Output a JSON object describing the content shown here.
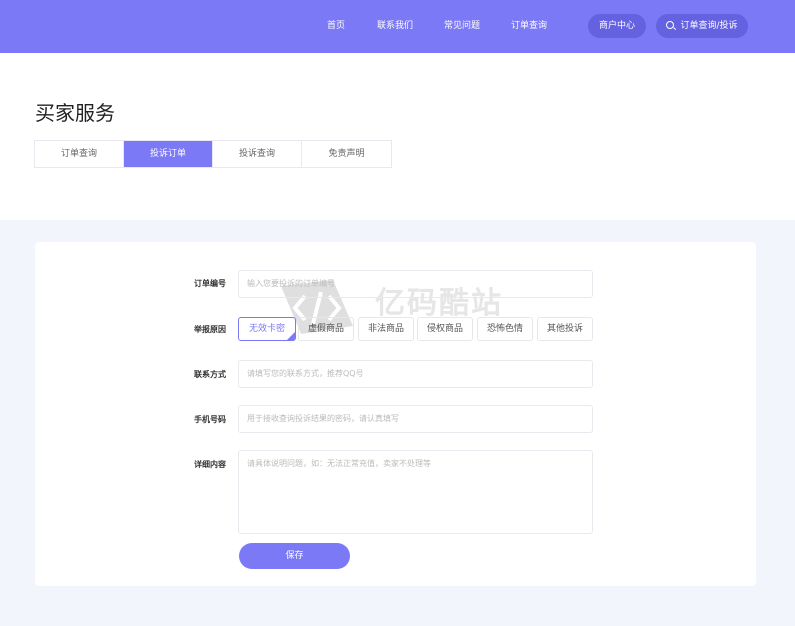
{
  "header": {
    "nav": [
      "首页",
      "联系我们",
      "常见问题",
      "订单查询"
    ],
    "merchant_button": "商户中心",
    "search_button": "订单查询/投诉"
  },
  "hero": {
    "title": "买家服务",
    "tabs": [
      "订单查询",
      "投诉订单",
      "投诉查询",
      "免责声明"
    ],
    "active_tab": "投诉订单"
  },
  "form": {
    "order_no": {
      "label": "订单编号",
      "placeholder": "输入您要投诉的订单编号"
    },
    "reason": {
      "label": "举报原因",
      "options": [
        "无效卡密",
        "虚假商品",
        "非法商品",
        "侵权商品",
        "恐怖色情",
        "其他投诉"
      ],
      "selected": "无效卡密"
    },
    "contact": {
      "label": "联系方式",
      "placeholder": "请填写您的联系方式，推荐QQ号"
    },
    "phone": {
      "label": "手机号码",
      "placeholder": "用于接收查询投诉结果的密码，请认真填写"
    },
    "detail": {
      "label": "详细内容",
      "placeholder": "请具体说明问题，如：无法正常充值，卖家不处理等"
    },
    "save_label": "保存"
  },
  "watermark": {
    "text": "亿码酷站"
  },
  "colors": {
    "primary": "#7b79f5",
    "pill": "#6462e0",
    "background": "#f3f5fc"
  }
}
